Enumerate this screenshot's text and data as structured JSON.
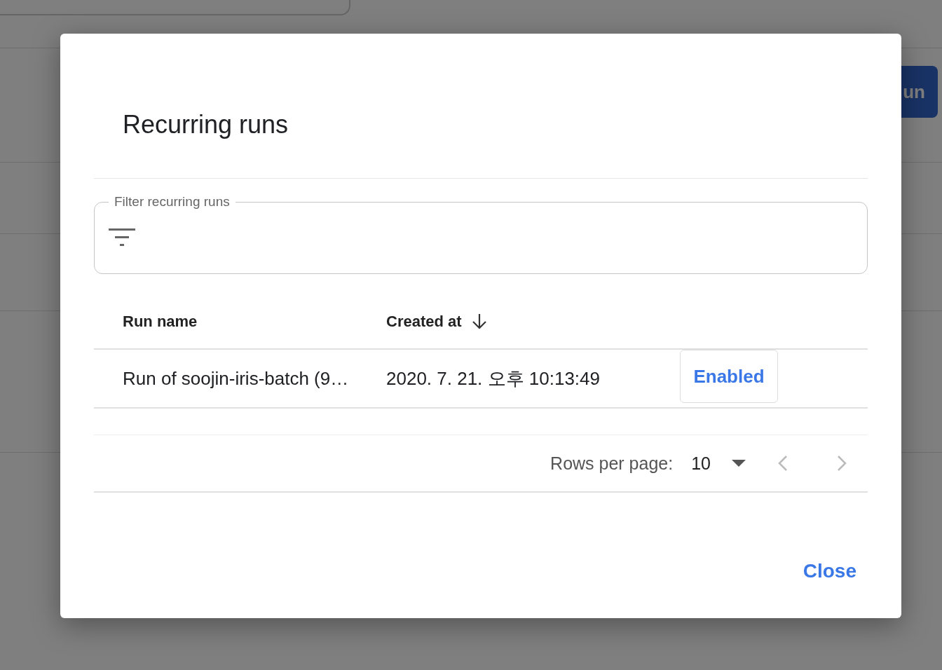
{
  "background": {
    "button_label": "un"
  },
  "dialog": {
    "title": "Recurring runs",
    "filter": {
      "label": "Filter recurring runs"
    },
    "table": {
      "columns": [
        {
          "label": "Run name",
          "sorted": false
        },
        {
          "label": "Created at",
          "sorted": true
        }
      ],
      "rows": [
        {
          "run_name": "Run of soojin-iris-batch (9…",
          "created_at": "2020. 7. 21. 오후 10:13:49",
          "status": "Enabled"
        }
      ]
    },
    "pagination": {
      "label": "Rows per page:",
      "value": "10"
    },
    "buttons": [
      {
        "label": "Close"
      }
    ]
  }
}
